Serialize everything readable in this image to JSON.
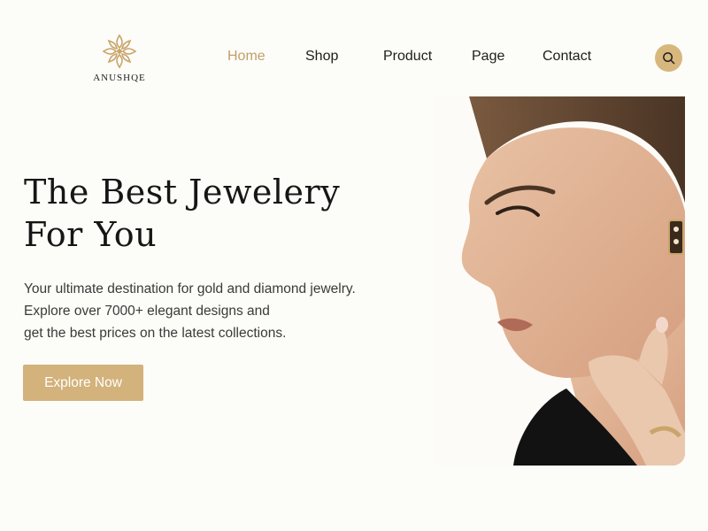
{
  "brand": {
    "name": "ANUSHQE",
    "accent": "#c2a068",
    "button_color": "#d3b27b",
    "logo_icon": "floral-ornament-icon"
  },
  "nav": {
    "items": [
      {
        "label": "Home",
        "active": true
      },
      {
        "label": "Shop",
        "active": false
      },
      {
        "label": "Product",
        "active": false
      },
      {
        "label": "Page",
        "active": false
      },
      {
        "label": "Contact",
        "active": false
      }
    ],
    "search_icon": "search-icon"
  },
  "hero": {
    "title_line1": "The Best Jewelery",
    "title_line2": "For You",
    "desc_line1": "Your ultimate destination for gold and diamond jewelry.",
    "desc_line2": "Explore over 7000+ elegant designs and",
    "desc_line3": "get the best prices on the latest collections.",
    "cta_label": "Explore Now",
    "image_subject": "woman-portrait-with-earring"
  }
}
